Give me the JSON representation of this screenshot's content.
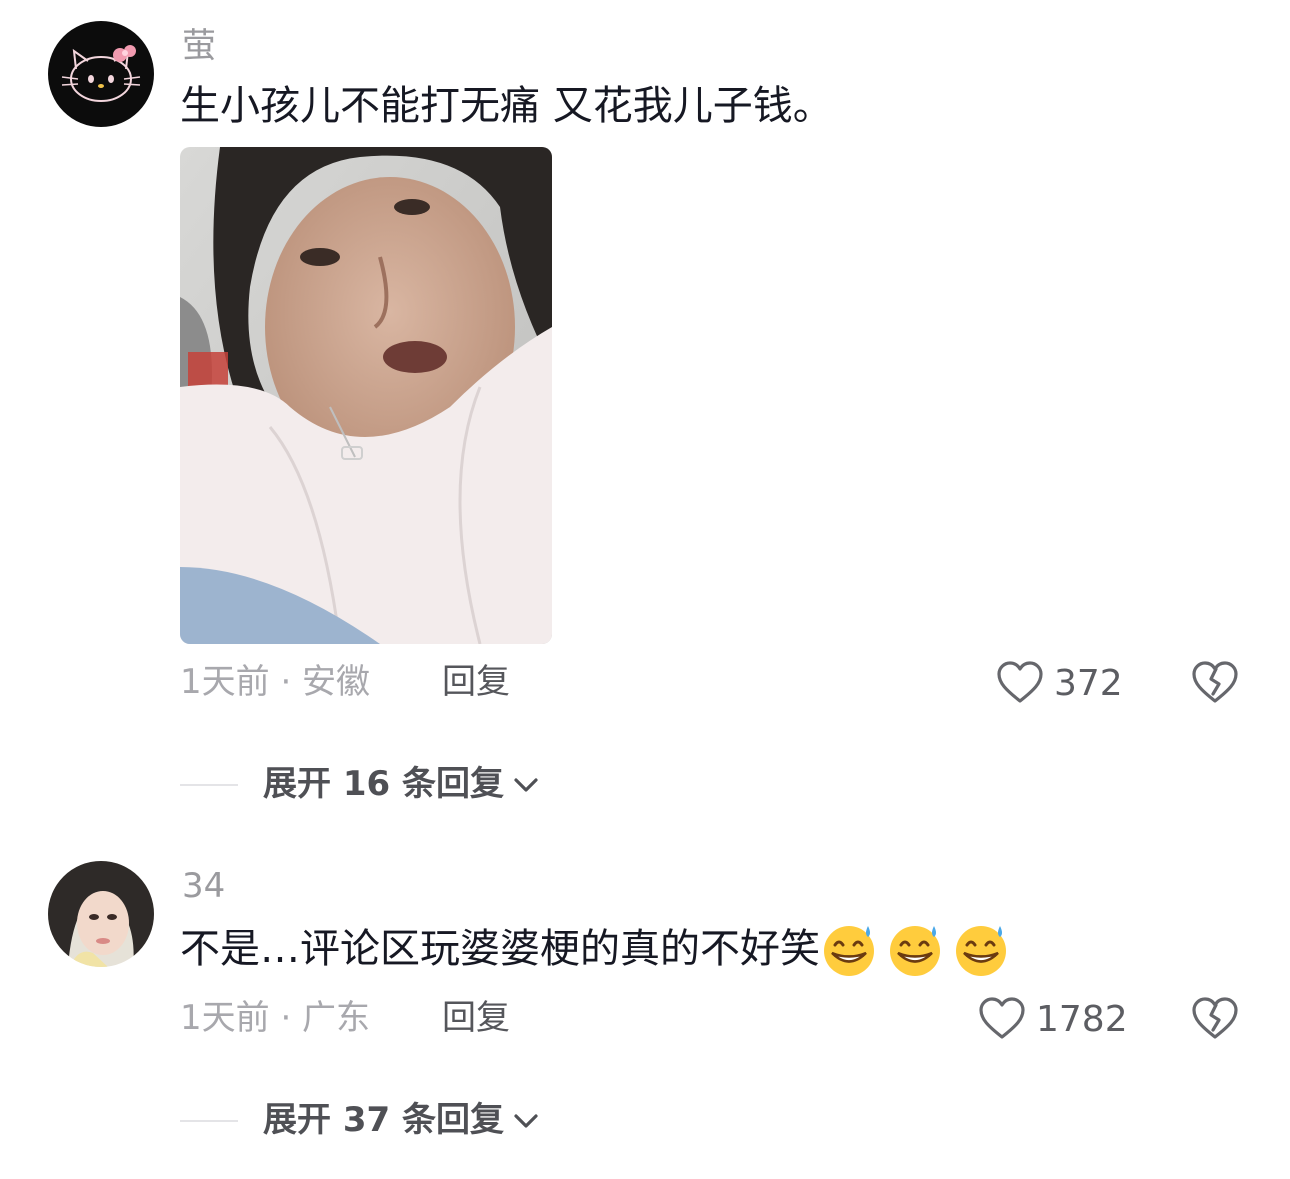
{
  "colors": {
    "text_primary": "#161823",
    "text_secondary": "#a8a8ad",
    "username": "#9a9a9e",
    "action": "#55565b",
    "divider": "#e4e4e7"
  },
  "comments": [
    {
      "username": "萤",
      "text": "生小孩儿不能打无痛 又花我儿子钱。",
      "has_image": true,
      "image_desc_icon": "photo-icon",
      "time_location": "1天前 · 安徽",
      "reply_label": "回复",
      "like_count": "372",
      "expand_label": "展开 16 条回复"
    },
    {
      "username": "34",
      "text": "不是…评论区玩婆婆梗的真的不好笑",
      "emojis": [
        "grin-sweat-emoji",
        "grin-sweat-emoji",
        "grin-sweat-emoji"
      ],
      "time_location": "1天前 · 广东",
      "reply_label": "回复",
      "like_count": "1782",
      "expand_label": "展开 37 条回复"
    }
  ]
}
